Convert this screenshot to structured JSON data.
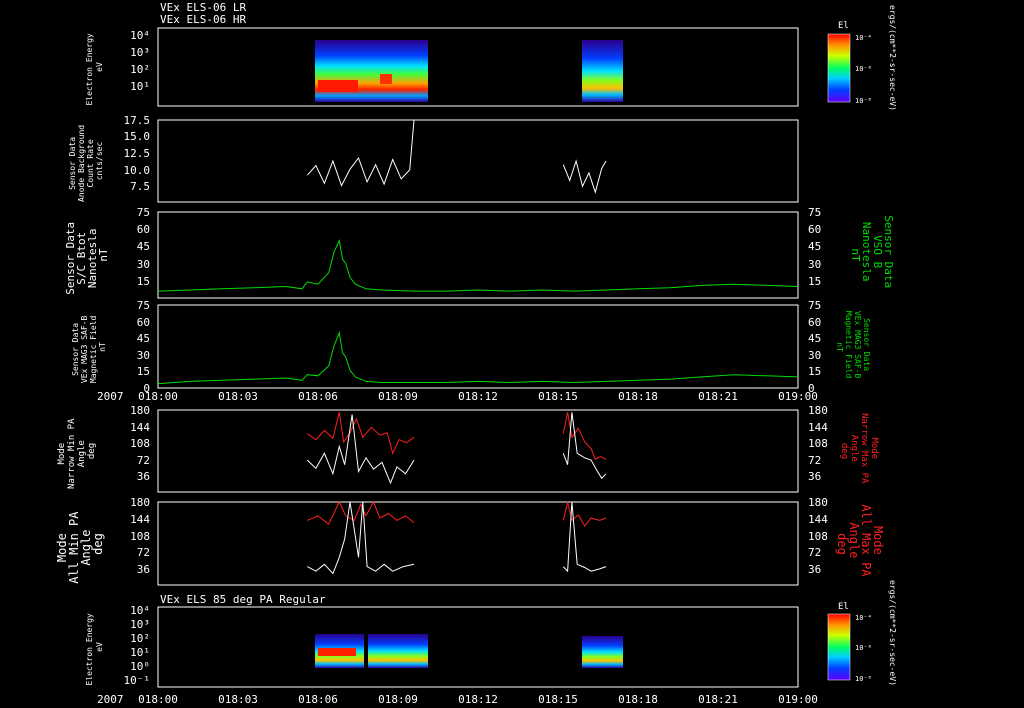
{
  "figure": {
    "header_lines": [
      "VEx ELS-06 LR",
      "VEx ELS-06 HR"
    ],
    "panel7_title": "VEx ELS 85 deg PA Regular",
    "year_label": "2007",
    "time_ticks": [
      "018:00",
      "018:03",
      "018:06",
      "018:09",
      "018:12",
      "018:15",
      "018:18",
      "018:21",
      "019:00"
    ],
    "colorbar_title": "El",
    "colorbar_unit": "ergs/(cm**2-sr-sec-eV)",
    "colorbar_ticks": [
      "10⁻⁴",
      "10⁻⁶",
      "10⁻⁸"
    ]
  },
  "colors": {
    "background": "#000000",
    "axis": "#ffffff",
    "green": "#00dd00",
    "red": "#ff2020",
    "white": "#ffffff"
  },
  "chart_data": [
    {
      "type": "heatmap",
      "ylabel": [
        "Electron Energy",
        "eV"
      ],
      "yscale": "log",
      "yticks": [
        "10⁴",
        "10³",
        "10²",
        "10¹"
      ],
      "x_domain_minutes": [
        0,
        60
      ],
      "coverage_minutes": [
        [
          14.0,
          24.0
        ],
        [
          38.0,
          42.0
        ]
      ],
      "colorbar": "rainbow"
    },
    {
      "type": "line",
      "ylabel": [
        "Sensor Data",
        "Anode Background",
        "Count Rate",
        "cnts/sec"
      ],
      "ylim": [
        6.5,
        17.5
      ],
      "yticks": [
        "17.5",
        "15.0",
        "12.5",
        "10.0",
        "7.5"
      ],
      "series": [
        {
          "color": "white",
          "segments": [
            [
              [
                14.0,
                10.1
              ],
              [
                14.8,
                11.4
              ],
              [
                15.6,
                9.0
              ],
              [
                16.4,
                12.0
              ],
              [
                17.2,
                8.7
              ],
              [
                18.0,
                10.9
              ],
              [
                18.8,
                12.4
              ],
              [
                19.6,
                9.2
              ],
              [
                20.4,
                11.5
              ],
              [
                21.2,
                8.9
              ],
              [
                22.0,
                12.2
              ],
              [
                22.8,
                9.6
              ],
              [
                23.6,
                10.8
              ],
              [
                24.0,
                17.5
              ]
            ],
            [
              [
                38.0,
                11.5
              ],
              [
                38.6,
                9.4
              ],
              [
                39.2,
                12.0
              ],
              [
                39.8,
                8.6
              ],
              [
                40.4,
                10.4
              ],
              [
                41.0,
                7.8
              ],
              [
                41.6,
                11.0
              ],
              [
                42.0,
                12.0
              ]
            ]
          ]
        }
      ]
    },
    {
      "type": "line",
      "ylabel": [
        "Sensor Data",
        "S/C Btot",
        "Nanotesla",
        "nT"
      ],
      "ylabel_right": [
        "Sensor Data",
        "VSO B",
        "Nanotesla",
        "nT"
      ],
      "ylim": [
        0,
        75
      ],
      "yticks": [
        "75",
        "60",
        "45",
        "30",
        "15"
      ],
      "series": [
        {
          "color": "green",
          "points": [
            [
              0,
              6
            ],
            [
              3,
              7
            ],
            [
              6,
              8
            ],
            [
              9,
              9
            ],
            [
              12,
              10
            ],
            [
              13.5,
              8
            ],
            [
              14.0,
              14
            ],
            [
              15.0,
              12
            ],
            [
              16.0,
              22
            ],
            [
              16.5,
              40
            ],
            [
              17.0,
              50
            ],
            [
              17.3,
              34
            ],
            [
              17.6,
              30
            ],
            [
              18.0,
              18
            ],
            [
              18.5,
              12
            ],
            [
              19.5,
              8
            ],
            [
              21,
              7
            ],
            [
              24,
              6
            ],
            [
              27,
              6
            ],
            [
              30,
              7
            ],
            [
              33,
              6
            ],
            [
              36,
              7
            ],
            [
              39,
              6
            ],
            [
              42,
              7
            ],
            [
              45,
              8
            ],
            [
              48,
              9
            ],
            [
              51,
              11
            ],
            [
              54,
              12
            ],
            [
              57,
              11
            ],
            [
              60,
              10
            ]
          ]
        }
      ]
    },
    {
      "type": "line",
      "ylabel": [
        "Sensor Data",
        "VEx MAG3 SAF-B",
        "Magnetic Field",
        "nT"
      ],
      "ylabel_right": [
        "Sensor Data",
        "VEx MAG3 SAF-B",
        "Magnetic Field",
        "nT"
      ],
      "ylim": [
        0,
        75
      ],
      "yticks": [
        "75",
        "60",
        "45",
        "30",
        "15",
        "0"
      ],
      "series": [
        {
          "color": "green",
          "points": [
            [
              0,
              4
            ],
            [
              3,
              6
            ],
            [
              6,
              7
            ],
            [
              9,
              8
            ],
            [
              12,
              9
            ],
            [
              13.5,
              7
            ],
            [
              14.0,
              12
            ],
            [
              15.0,
              11
            ],
            [
              16.0,
              20
            ],
            [
              16.5,
              38
            ],
            [
              17.0,
              50
            ],
            [
              17.3,
              32
            ],
            [
              17.6,
              28
            ],
            [
              18.0,
              16
            ],
            [
              18.5,
              10
            ],
            [
              19.5,
              6
            ],
            [
              21,
              5
            ],
            [
              24,
              5
            ],
            [
              27,
              5
            ],
            [
              30,
              6
            ],
            [
              33,
              5
            ],
            [
              36,
              6
            ],
            [
              39,
              5
            ],
            [
              42,
              6
            ],
            [
              45,
              7
            ],
            [
              48,
              8
            ],
            [
              51,
              10
            ],
            [
              54,
              12
            ],
            [
              57,
              11
            ],
            [
              60,
              10
            ]
          ]
        }
      ]
    },
    {
      "type": "line",
      "ylabel": [
        "Mode",
        "Narrow Min PA",
        "Angle",
        "deg"
      ],
      "ylabel_right": [
        "Mode",
        "Narrow Max PA",
        "Angle",
        "deg"
      ],
      "ylim": [
        0,
        180
      ],
      "yticks": [
        "180",
        "144",
        "108",
        "72",
        "36"
      ],
      "series": [
        {
          "color": "red",
          "segments": [
            [
              [
                14.0,
                128
              ],
              [
                14.8,
                115
              ],
              [
                15.6,
                135
              ],
              [
                16.4,
                118
              ],
              [
                17.0,
                175
              ],
              [
                17.4,
                110
              ],
              [
                18.0,
                130
              ],
              [
                18.6,
                160
              ],
              [
                19.2,
                120
              ],
              [
                20.0,
                142
              ],
              [
                20.8,
                125
              ],
              [
                21.5,
                130
              ],
              [
                22.0,
                85
              ],
              [
                22.6,
                115
              ],
              [
                23.3,
                108
              ],
              [
                24.0,
                120
              ]
            ],
            [
              [
                38.0,
                128
              ],
              [
                38.4,
                175
              ],
              [
                38.8,
                120
              ],
              [
                39.4,
                140
              ],
              [
                40.0,
                110
              ],
              [
                40.6,
                95
              ],
              [
                41.0,
                72
              ],
              [
                41.5,
                78
              ],
              [
                42.0,
                72
              ]
            ]
          ]
        },
        {
          "color": "white",
          "segments": [
            [
              [
                14.0,
                70
              ],
              [
                14.8,
                52
              ],
              [
                15.6,
                85
              ],
              [
                16.4,
                40
              ],
              [
                17.0,
                100
              ],
              [
                17.5,
                60
              ],
              [
                18.2,
                170
              ],
              [
                18.8,
                45
              ],
              [
                19.5,
                75
              ],
              [
                20.2,
                50
              ],
              [
                21.0,
                65
              ],
              [
                21.8,
                20
              ],
              [
                22.4,
                55
              ],
              [
                23.2,
                40
              ],
              [
                24.0,
                70
              ]
            ],
            [
              [
                38.0,
                85
              ],
              [
                38.4,
                60
              ],
              [
                38.8,
                175
              ],
              [
                39.3,
                85
              ],
              [
                40.0,
                75
              ],
              [
                40.6,
                70
              ],
              [
                41.2,
                45
              ],
              [
                41.6,
                30
              ],
              [
                42.0,
                40
              ]
            ]
          ]
        }
      ]
    },
    {
      "type": "line",
      "ylabel": [
        "Mode",
        "All Min PA",
        "Angle",
        "deg"
      ],
      "ylabel_right": [
        "Mode",
        "All Max PA",
        "Angle",
        "deg"
      ],
      "ylim": [
        0,
        180
      ],
      "yticks": [
        "180",
        "144",
        "108",
        "72",
        "36"
      ],
      "series": [
        {
          "color": "red",
          "segments": [
            [
              [
                14.0,
                140
              ],
              [
                15.0,
                150
              ],
              [
                16.0,
                132
              ],
              [
                17.0,
                180
              ],
              [
                17.6,
                150
              ],
              [
                18.4,
                140
              ],
              [
                19.0,
                175
              ],
              [
                19.5,
                150
              ],
              [
                20.2,
                180
              ],
              [
                20.8,
                145
              ],
              [
                21.6,
                155
              ],
              [
                22.4,
                140
              ],
              [
                23.2,
                150
              ],
              [
                24.0,
                135
              ]
            ],
            [
              [
                38.0,
                140
              ],
              [
                38.4,
                180
              ],
              [
                38.8,
                140
              ],
              [
                39.4,
                152
              ],
              [
                40.0,
                128
              ],
              [
                40.6,
                145
              ],
              [
                41.4,
                140
              ],
              [
                42.0,
                145
              ]
            ]
          ]
        },
        {
          "color": "white",
          "segments": [
            [
              [
                14.0,
                40
              ],
              [
                14.8,
                30
              ],
              [
                15.6,
                45
              ],
              [
                16.4,
                25
              ],
              [
                17.0,
                60
              ],
              [
                17.5,
                100
              ],
              [
                18.0,
                180
              ],
              [
                18.4,
                120
              ],
              [
                18.8,
                60
              ],
              [
                19.2,
                180
              ],
              [
                19.6,
                40
              ],
              [
                20.4,
                30
              ],
              [
                21.2,
                45
              ],
              [
                22.0,
                30
              ],
              [
                23.0,
                40
              ],
              [
                24.0,
                45
              ]
            ],
            [
              [
                38.0,
                40
              ],
              [
                38.4,
                30
              ],
              [
                38.8,
                180
              ],
              [
                39.3,
                45
              ],
              [
                40.0,
                38
              ],
              [
                40.6,
                30
              ],
              [
                41.4,
                35
              ],
              [
                42.0,
                40
              ]
            ]
          ]
        }
      ]
    },
    {
      "type": "heatmap",
      "title": "VEx ELS 85 deg PA Regular",
      "ylabel": [
        "Electron Energy",
        "eV"
      ],
      "yscale": "log",
      "yticks": [
        "10⁴",
        "10³",
        "10²",
        "10¹",
        "10⁰",
        "10⁻¹"
      ],
      "x_domain_minutes": [
        0,
        60
      ],
      "coverage_minutes": [
        [
          14.0,
          24.0
        ],
        [
          38.0,
          42.0
        ]
      ],
      "colorbar": "rainbow"
    }
  ]
}
